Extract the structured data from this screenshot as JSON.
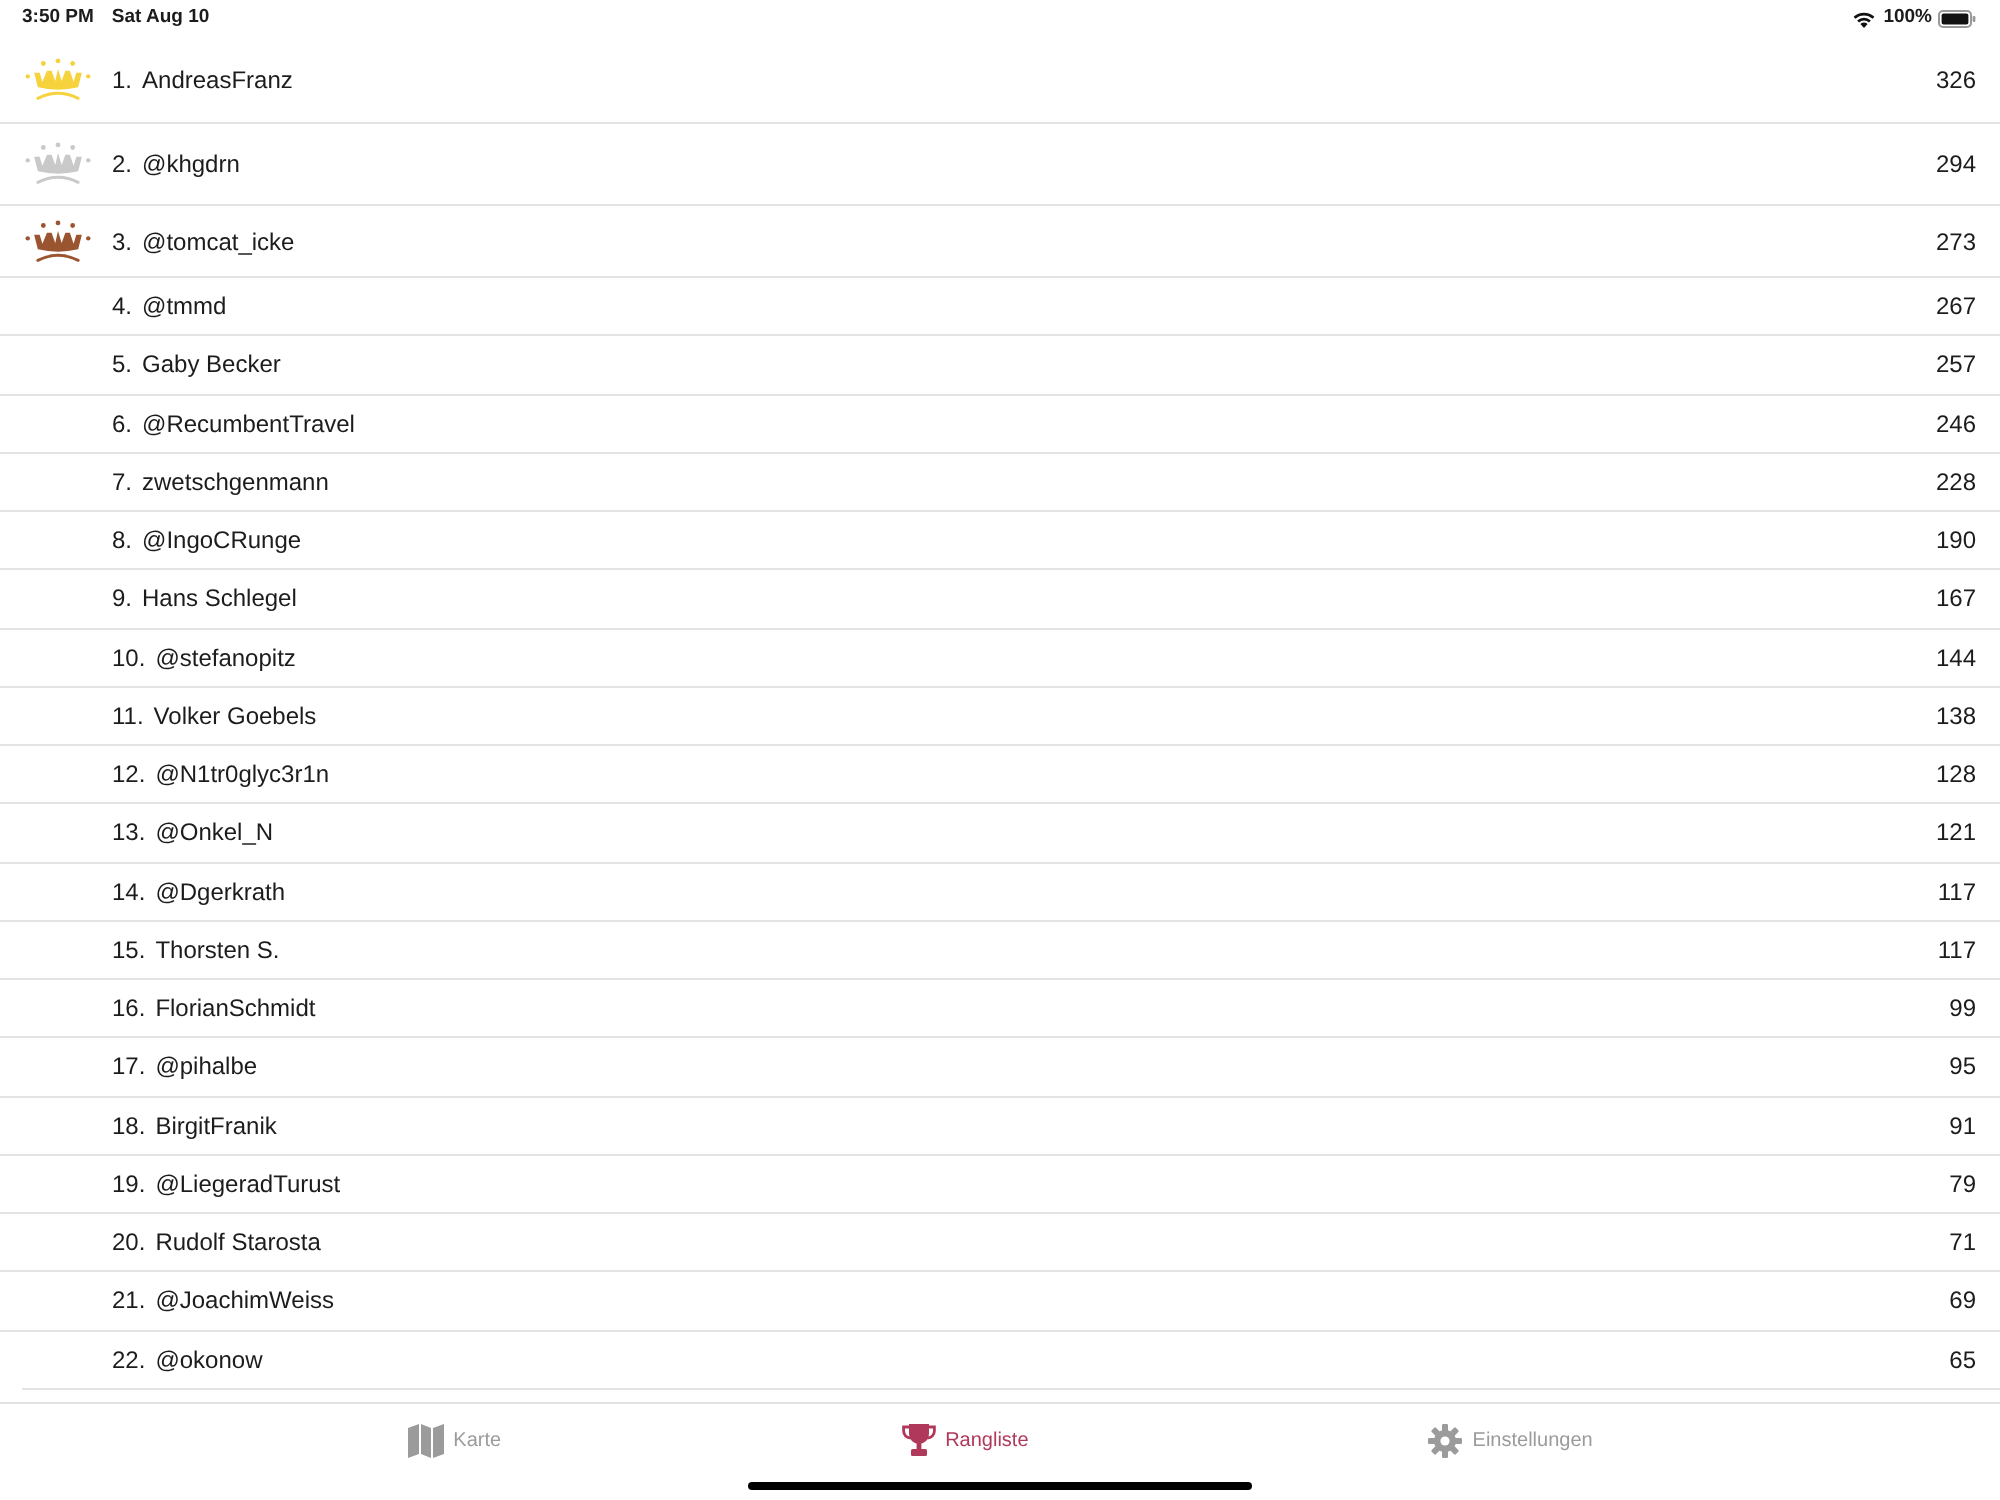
{
  "status_bar": {
    "time": "3:50 PM",
    "date": "Sat Aug 10",
    "battery": "100%"
  },
  "leaderboard": [
    {
      "rank": "1.",
      "name": "AndreasFranz",
      "score": "326",
      "color": "#f6d33c"
    },
    {
      "rank": "2.",
      "name": "@khgdrn",
      "score": "294",
      "color": "#c9c9c9"
    },
    {
      "rank": "3.",
      "name": "@tomcat_icke",
      "score": "273",
      "color": "#9a5530"
    },
    {
      "rank": "4.",
      "name": "@tmmd",
      "score": "267"
    },
    {
      "rank": "5.",
      "name": "Gaby Becker",
      "score": "257"
    },
    {
      "rank": "6.",
      "name": "@RecumbentTravel",
      "score": "246"
    },
    {
      "rank": "7.",
      "name": "zwetschgenmann",
      "score": "228"
    },
    {
      "rank": "8.",
      "name": "@IngoCRunge",
      "score": "190"
    },
    {
      "rank": "9.",
      "name": "Hans Schlegel",
      "score": "167"
    },
    {
      "rank": "10.",
      "name": "@stefanopitz",
      "score": "144"
    },
    {
      "rank": "11.",
      "name": "Volker Goebels",
      "score": "138"
    },
    {
      "rank": "12.",
      "name": "@N1tr0glyc3r1n",
      "score": "128"
    },
    {
      "rank": "13.",
      "name": "@Onkel_N",
      "score": "121"
    },
    {
      "rank": "14.",
      "name": "@Dgerkrath",
      "score": "117"
    },
    {
      "rank": "15.",
      "name": "Thorsten S.",
      "score": "117"
    },
    {
      "rank": "16.",
      "name": "FlorianSchmidt",
      "score": "99"
    },
    {
      "rank": "17.",
      "name": "@pihalbe",
      "score": "95"
    },
    {
      "rank": "18.",
      "name": "BirgitFranik",
      "score": "91"
    },
    {
      "rank": "19.",
      "name": "@LiegeradTurust",
      "score": "79"
    },
    {
      "rank": "20.",
      "name": "Rudolf Starosta",
      "score": "71"
    },
    {
      "rank": "21.",
      "name": "@JoachimWeiss",
      "score": "69"
    },
    {
      "rank": "22.",
      "name": "@okonow",
      "score": "65"
    }
  ],
  "tab_bar": [
    {
      "label": "Karte",
      "selected": false
    },
    {
      "label": "Rangliste",
      "selected": true
    },
    {
      "label": "Einstellungen",
      "selected": false
    }
  ]
}
